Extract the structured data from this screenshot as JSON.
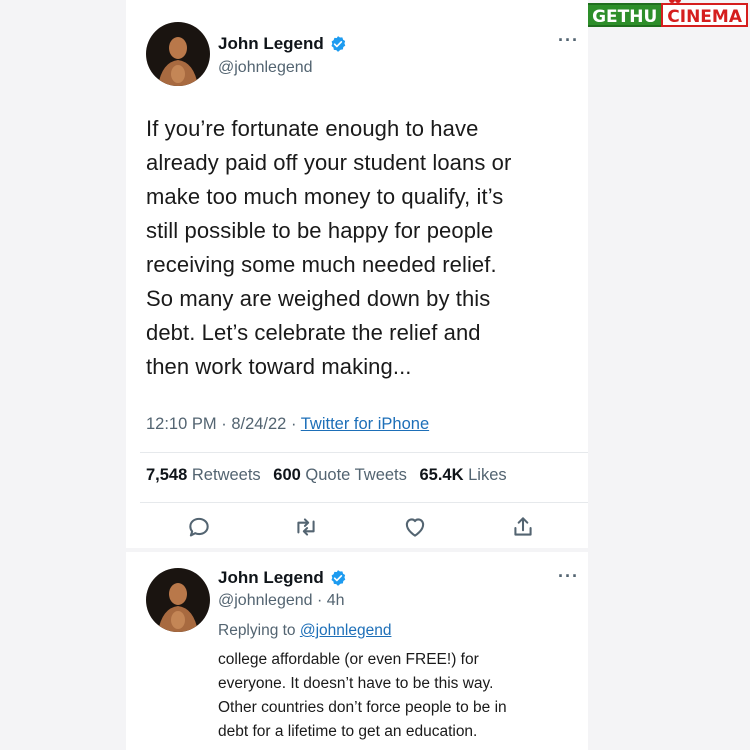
{
  "watermark": {
    "left": "GETHU",
    "right": "CINEMA"
  },
  "tweet": {
    "author": {
      "name": "John Legend",
      "handle": "@johnlegend"
    },
    "more_icon": "more-horizontal-icon",
    "text_lines": [
      "If you’re fortunate enough to have",
      "already paid off your student loans or",
      "make too much money to qualify, it’s",
      "still possible to be happy for people",
      "receiving some much needed relief.",
      "So many are weighed down by this",
      "debt. Let’s celebrate the relief and",
      "then work toward making..."
    ],
    "time": "12:10 PM",
    "date": "8/24/22",
    "source": "Twitter for iPhone",
    "stats": {
      "retweets_count": "7,548",
      "retweets_label": "Retweets",
      "quotes_count": "600",
      "quotes_label": "Quote Tweets",
      "likes_count": "65.4K",
      "likes_label": "Likes"
    },
    "actions": [
      "reply-icon",
      "retweet-icon",
      "like-icon",
      "share-icon"
    ]
  },
  "reply": {
    "author": {
      "name": "John Legend",
      "handle": "@johnlegend",
      "age": "4h"
    },
    "replying_to_label": "Replying to",
    "replying_to_handle": "@johnlegend",
    "text_lines": [
      "college affordable (or even FREE!) for",
      "everyone. It doesn’t have to be this way.",
      "Other countries don’t force people to be in",
      "debt for a lifetime to get an education."
    ]
  },
  "colors": {
    "verified": "#1d9bf0",
    "link": "#1d6fb8",
    "muted": "#536471",
    "watermark_green": "#2d8e2a",
    "watermark_red": "#d51e1e"
  }
}
